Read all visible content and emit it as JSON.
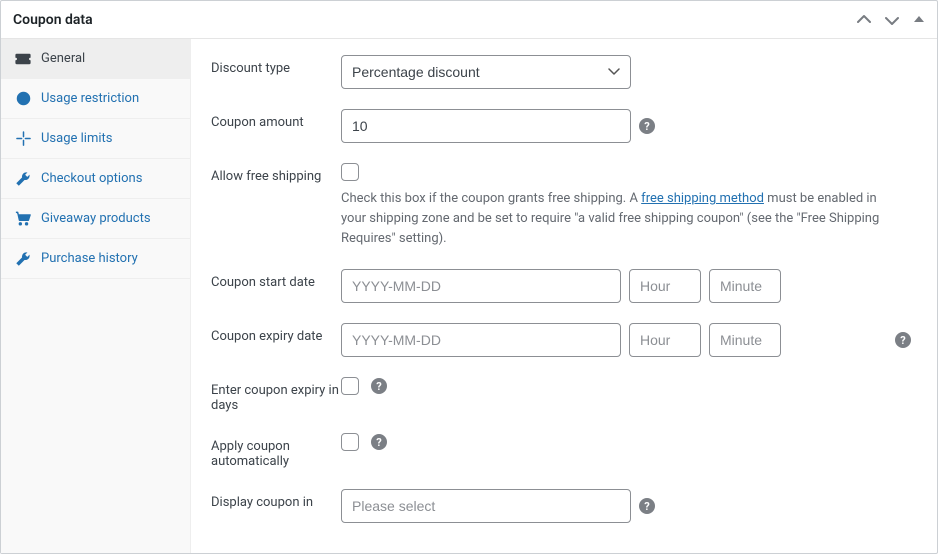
{
  "panel": {
    "title": "Coupon data"
  },
  "sidebar": {
    "items": [
      {
        "label": "General"
      },
      {
        "label": "Usage restriction"
      },
      {
        "label": "Usage limits"
      },
      {
        "label": "Checkout options"
      },
      {
        "label": "Giveaway products"
      },
      {
        "label": "Purchase history"
      }
    ]
  },
  "fields": {
    "discount_type": {
      "label": "Discount type",
      "selected": "Percentage discount"
    },
    "coupon_amount": {
      "label": "Coupon amount",
      "value": "10"
    },
    "free_shipping": {
      "label": "Allow free shipping",
      "text_before": "Check this box if the coupon grants free shipping. A ",
      "link_text": "free shipping method",
      "text_after": " must be enabled in your shipping zone and be set to require \"a valid free shipping coupon\" (see the \"Free Shipping Requires\" setting)."
    },
    "start_date": {
      "label": "Coupon start date",
      "date_ph": "YYYY-MM-DD",
      "hour_ph": "Hour",
      "minute_ph": "Minute"
    },
    "expiry_date": {
      "label": "Coupon expiry date",
      "date_ph": "YYYY-MM-DD",
      "hour_ph": "Hour",
      "minute_ph": "Minute"
    },
    "expiry_days": {
      "label": "Enter coupon expiry in days"
    },
    "apply_auto": {
      "label": "Apply coupon automatically"
    },
    "display_in": {
      "label": "Display coupon in",
      "placeholder": "Please select"
    }
  }
}
